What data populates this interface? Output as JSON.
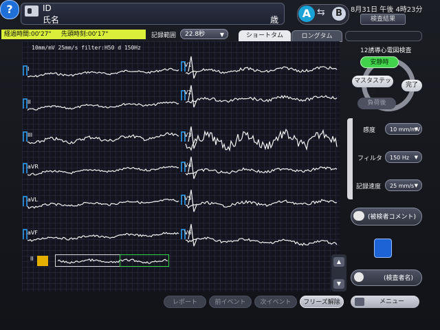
{
  "header": {
    "patient_id_label": "ID",
    "patient_name_label": "氏名",
    "age_unit": "歳",
    "mode_a": "A",
    "mode_b": "B",
    "swap_symbol": "⇆",
    "datetime": "8月31日 午後 4時23分",
    "results_button": "検査結果"
  },
  "info_row": {
    "elapsed_label": "経過時間:00'27\"",
    "lead_time_label": "先頭時刻:00'17\"",
    "record_range_label": "記録範囲",
    "record_range_value": "22.8秒",
    "tabs": [
      "ショートタム",
      "ロングタム"
    ]
  },
  "ecg": {
    "settings_line": "10mm/mV 25mm/s filter:H50 d 150Hz",
    "leads_left": [
      "I",
      "II",
      "III",
      "aVR",
      "aVL",
      "aVF"
    ],
    "leads_right": [
      "V1",
      "V2",
      "V3",
      "V4",
      "V5",
      "V6"
    ],
    "rhythm_label": "II"
  },
  "right_panel": {
    "title": "12誘導心電図検査",
    "workflow": {
      "rest": "安静時",
      "master": "マスタステップ",
      "done": "完了",
      "load": "負荷後"
    },
    "settings": [
      {
        "label": "感度",
        "value": "10 mm/mV"
      },
      {
        "label": "フィルタ",
        "value": "150 Hz"
      },
      {
        "label": "記録速度",
        "value": "25 mm/s"
      }
    ],
    "comment_button": "(被検者コメント)",
    "examiner_button": "(検査者名)",
    "help_symbol": "?"
  },
  "bottom_buttons": {
    "report": "レポート",
    "prev_event": "前イベント",
    "next_event": "次イベント",
    "freeze_release": "フリーズ解除",
    "menu": "メニュー"
  },
  "colors": {
    "elapsed_bg": "#d9ef3a",
    "rest_active": "#42d24c",
    "rhythm_select": "#35d241",
    "ab_active": "#1aa3d6"
  }
}
